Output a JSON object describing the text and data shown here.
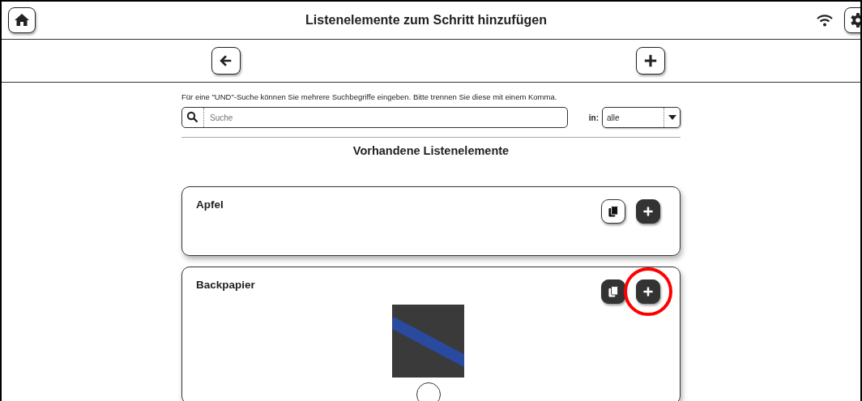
{
  "header": {
    "title": "Listenelemente zum Schritt hinzufügen"
  },
  "search": {
    "hint": "Für eine \"UND\"-Suche können Sie mehrere Suchbegriffe eingeben. Bitte trennen Sie diese mit einem Komma.",
    "placeholder": "Suche",
    "scope_label": "in:",
    "scope_value": "alle"
  },
  "section_title": "Vorhandene Listenelemente",
  "items": [
    {
      "name": "Apfel",
      "copy_dark": false,
      "highlighted": false,
      "has_photo": false
    },
    {
      "name": "Backpapier",
      "copy_dark": true,
      "highlighted": true,
      "has_photo": true
    }
  ]
}
